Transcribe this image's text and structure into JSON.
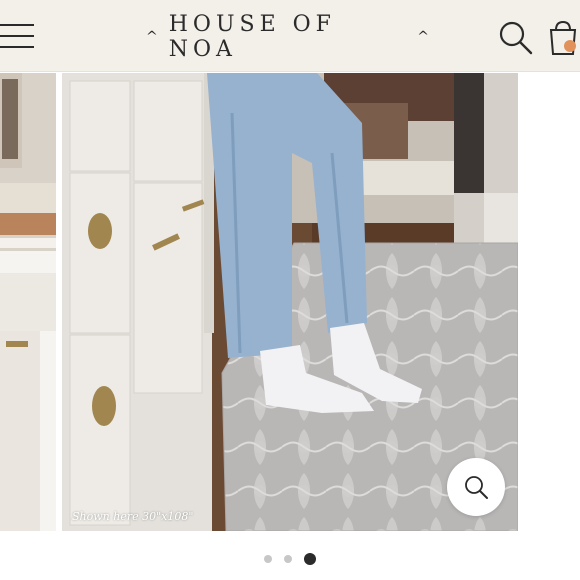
{
  "header": {
    "brand": "HOUSE OF NOA",
    "menu_icon": "hamburger-menu-icon",
    "search_icon": "search-icon",
    "cart_icon": "shopping-bag-icon",
    "cart_badge_color": "#e0925a"
  },
  "gallery": {
    "caption": "Shown here 30\"x108\"",
    "zoom_icon": "zoom-search-icon",
    "active_slide": 3,
    "slide_count": 3
  },
  "colors": {
    "header_bg": "#f3efe9",
    "text": "#2b2b2b",
    "rug": "#b9b7b6",
    "dot_inactive": "#c7c7c7",
    "dot_active": "#2b2b2b"
  }
}
